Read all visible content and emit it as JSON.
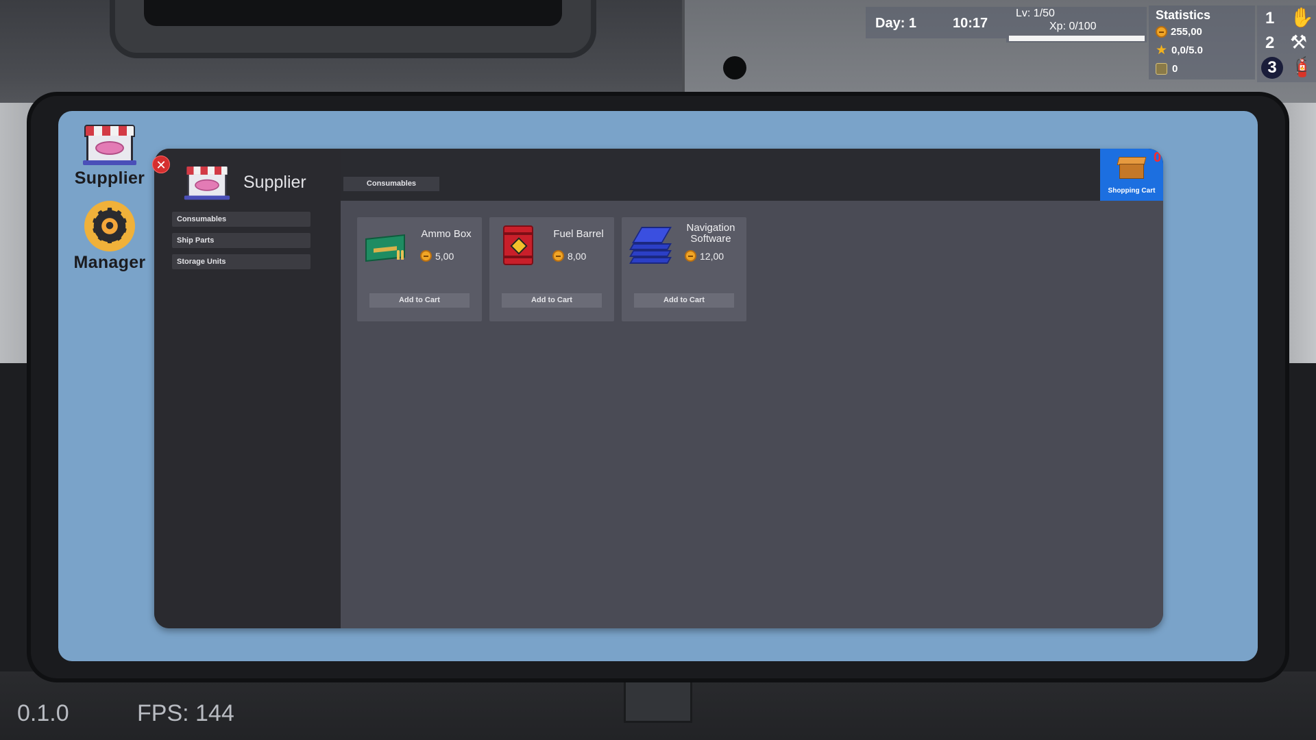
{
  "hud": {
    "day": "Day: 1",
    "time": "10:17",
    "level": "Lv: 1/50",
    "xp": "Xp: 0/100",
    "xp_progress": 0,
    "stats_title": "Statistics",
    "money": "255,00",
    "rating": "0,0/5.0",
    "crew": "0",
    "hotbar": [
      {
        "num": "1",
        "icon": "hand-icon",
        "glyph": "✋"
      },
      {
        "num": "2",
        "icon": "hammer-icon",
        "glyph": "⚒"
      },
      {
        "num": "3",
        "icon": "extinguisher-icon",
        "glyph": "🧯"
      }
    ]
  },
  "desktop": {
    "icons": [
      {
        "label": "Supplier",
        "icon": "store-icon"
      },
      {
        "label": "Manager",
        "icon": "gear-icon"
      }
    ]
  },
  "window": {
    "title": "Supplier",
    "close_glyph": "✕",
    "nav": [
      "Consumables",
      "Ship Parts",
      "Storage Units"
    ],
    "active_tab": "Consumables",
    "cart": {
      "count": "0",
      "label": "Shopping Cart"
    },
    "products": [
      {
        "name": "Ammo Box",
        "price": "5,00",
        "button": "Add to Cart",
        "icon": "ammo-box-icon"
      },
      {
        "name": "Fuel Barrel",
        "price": "8,00",
        "button": "Add to Cart",
        "icon": "fuel-barrel-icon"
      },
      {
        "name": "Navigation Software",
        "price": "12,00",
        "button": "Add to Cart",
        "icon": "navigation-software-icon"
      }
    ]
  },
  "footer": {
    "version": "0.1.0",
    "fps": "FPS: 144"
  },
  "colors": {
    "screen_bg": "#7aa3c9",
    "cart_accent": "#1c6fe0",
    "close_red": "#d52f2f",
    "coin": "#f0a526"
  }
}
